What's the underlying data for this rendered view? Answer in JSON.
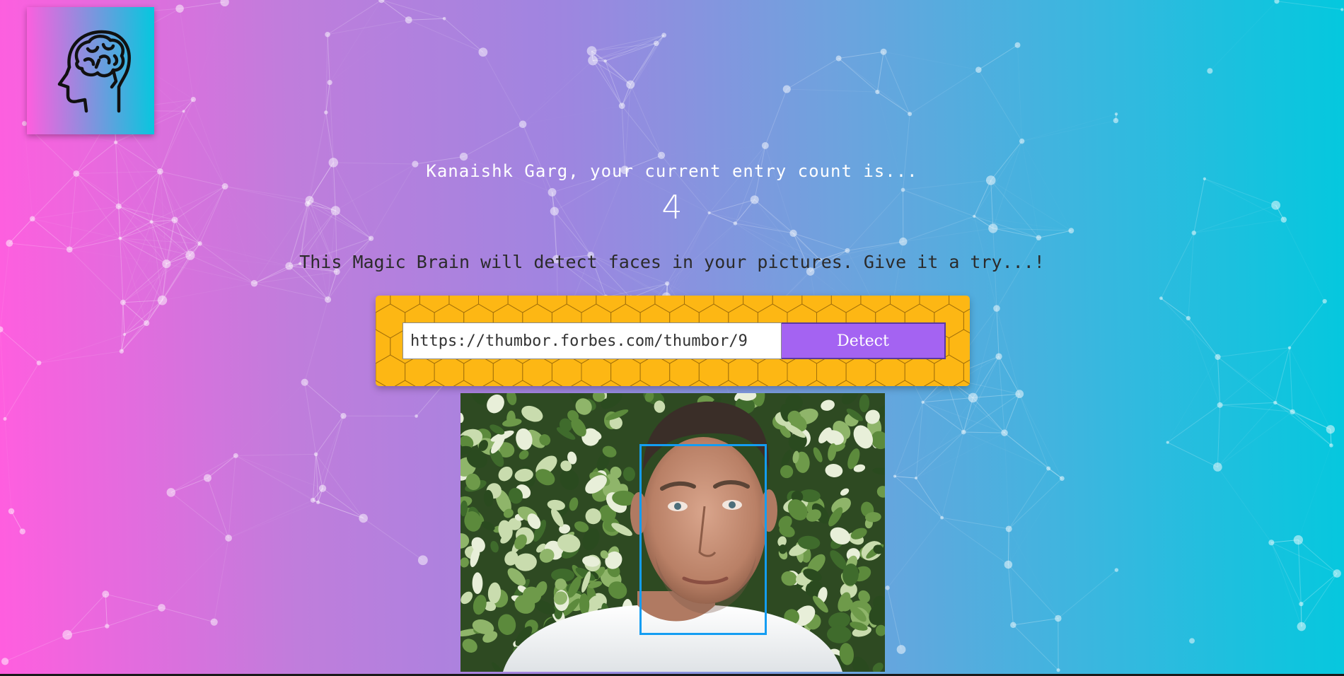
{
  "logo": {
    "icon": "brain-head-icon",
    "accent": "#111111"
  },
  "rank": {
    "message": "Kanaishk Garg, your current entry count is...",
    "count": "4"
  },
  "intro": {
    "text": "This Magic Brain will detect faces in your pictures. Give it a try...!"
  },
  "form": {
    "url_value": "https://thumbor.forbes.com/thumbor/9",
    "detect_label": "Detect",
    "panel_color": "#fdb714",
    "button_color": "#a463f2"
  },
  "result": {
    "image_subject": "man-portrait-photo",
    "box_color": "#149df2"
  },
  "background": {
    "gradient_start": "#ff5edf",
    "gradient_end": "#04c8de"
  }
}
